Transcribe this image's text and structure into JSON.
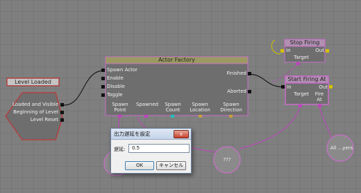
{
  "nodes": {
    "level_loaded": {
      "title": "Level Loaded",
      "outputs": [
        "Loaded and Visible",
        "Beginning of Level",
        "Level Reset"
      ]
    },
    "actor_factory": {
      "title": "Actor Factory",
      "inputs": [
        "Spawn Actor",
        "Enable",
        "Disable",
        "Toggle"
      ],
      "outputs": [
        "Finished",
        "Aborted"
      ],
      "variables": [
        "Spawn Point",
        "Spawned",
        "Spawn Count",
        "Spawn Location",
        "Spawn Direction"
      ]
    },
    "stop_firing": {
      "title": "Stop Firing",
      "input": "In",
      "output": "Out",
      "variable": "Target"
    },
    "start_firing_at": {
      "title": "Start Firing At",
      "input": "In",
      "output": "Out",
      "variables": [
        "Target",
        "Fire At"
      ]
    },
    "var_unknown": {
      "label": "???"
    },
    "var_all_players": {
      "label": "All ...yers"
    }
  },
  "dialog": {
    "title": "出力遅延を設定",
    "close_label": "x",
    "field_label": "遅延:",
    "field_value": "0.5",
    "ok_label": "OK",
    "cancel_label": "キャンセル"
  },
  "colors": {
    "canvas": "#7f7f7f",
    "node_body": "#6e6e6e",
    "actor_title": "#9a9a62",
    "event_title": "#b8b8b8",
    "action_title": "#b090b0",
    "selected_border": "#c86ec8",
    "event_border": "#b04040",
    "wire": "#1a1a1a",
    "variable_link": "#c040c0",
    "dialog_close": "#c4412d"
  }
}
